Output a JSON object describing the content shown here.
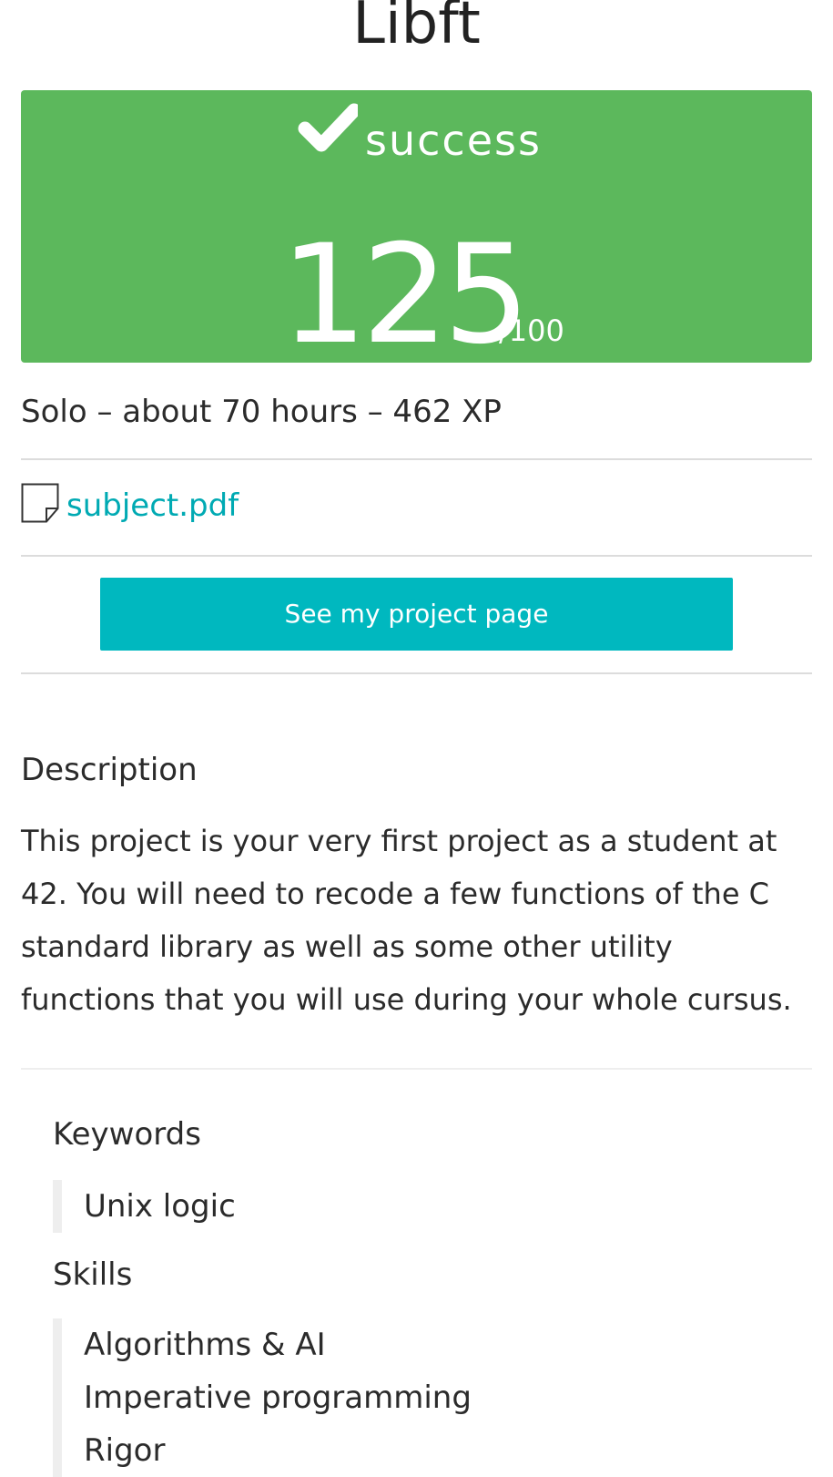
{
  "project": {
    "title": "Libft"
  },
  "result": {
    "status": "success",
    "mark": "125",
    "max_mark": "/100",
    "status_color": "#5cb85c",
    "status_icon": "check-icon"
  },
  "meta": {
    "line": "Solo – about 70 hours – 462 XP"
  },
  "attachment": {
    "icon": "document-icon",
    "name": "subject.pdf",
    "link_color": "#00aab3"
  },
  "actions": {
    "project_page_label": "See my project page",
    "button_color": "#00b8bf"
  },
  "description": {
    "heading": "Description",
    "text": "This project is your very first project as a student at 42. You will need to recode a few functions of the C standard library as well as some other utility functions that you will use during your whole cursus."
  },
  "keywords": {
    "heading": "Keywords",
    "items": [
      "Unix logic"
    ]
  },
  "skills": {
    "heading": "Skills",
    "items": [
      "Algorithms & AI",
      "Imperative programming",
      "Rigor"
    ]
  }
}
